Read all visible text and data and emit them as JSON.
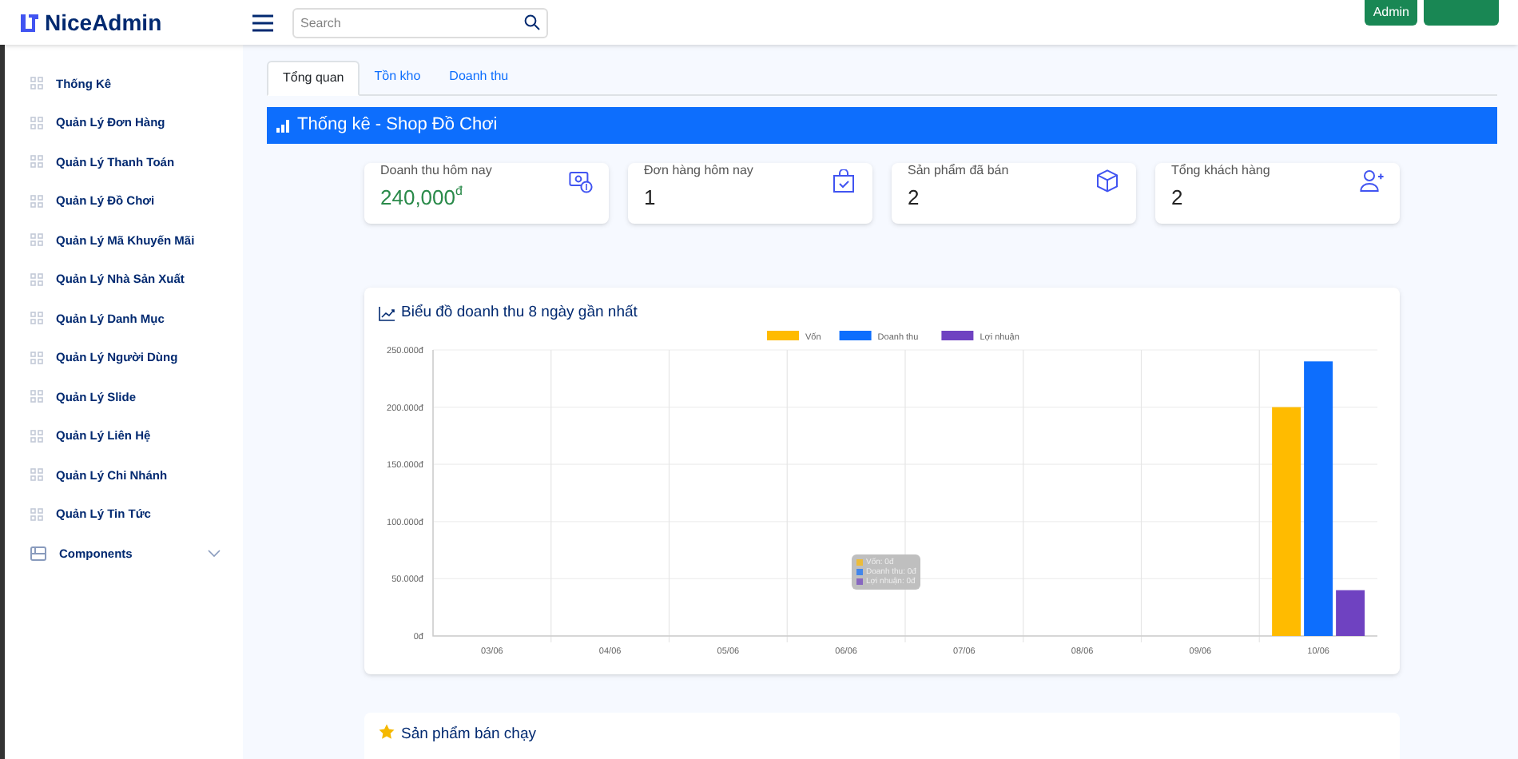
{
  "header": {
    "logo": "NiceAdmin",
    "search": {
      "placeholder": "Search"
    },
    "buttons": [
      "Admin"
    ]
  },
  "sidebar": {
    "items": [
      {
        "label": "Thống Kê",
        "kind": "link"
      },
      {
        "label": "Quản Lý Đơn Hàng",
        "kind": "link"
      },
      {
        "label": "Quản Lý Thanh Toán",
        "kind": "link"
      },
      {
        "label": "Quản Lý Đồ Chơi",
        "kind": "link"
      },
      {
        "label": "Quản Lý Mã Khuyến Mãi",
        "kind": "link"
      },
      {
        "label": "Quản Lý Nhà Sản Xuất",
        "kind": "link"
      },
      {
        "label": "Quản Lý Danh Mục",
        "kind": "link"
      },
      {
        "label": "Quản Lý Người Dùng",
        "kind": "link"
      },
      {
        "label": "Quản Lý Slide",
        "kind": "link"
      },
      {
        "label": "Quản Lý Liên Hệ",
        "kind": "link"
      },
      {
        "label": "Quản Lý Chi Nhánh",
        "kind": "link"
      },
      {
        "label": "Quản Lý Tin Tức",
        "kind": "link"
      },
      {
        "label": "Components",
        "kind": "group",
        "expanded": false
      }
    ]
  },
  "tabs": [
    {
      "label": "Tổng quan",
      "selected": true
    },
    {
      "label": "Tồn kho",
      "selected": false
    },
    {
      "label": "Doanh thu",
      "selected": false
    }
  ],
  "banner": "Thống kê - Shop Đồ Chơi",
  "stats": [
    {
      "label": "Doanh thu hôm nay",
      "value": "240,000",
      "unit": "đ",
      "kind": "money"
    },
    {
      "label": "Đơn hàng hôm nay",
      "value": "1",
      "kind": "bag"
    },
    {
      "label": "Sản phẩm đã bán",
      "value": "2",
      "kind": "box"
    },
    {
      "label": "Tổng khách hàng",
      "value": "2",
      "kind": "user"
    }
  ],
  "chart": {
    "title": "Biểu đồ doanh thu 8 ngày gần nhất",
    "chart_data": {
      "type": "bar",
      "categories": [
        "03/06",
        "04/06",
        "05/06",
        "06/06",
        "07/06",
        "08/06",
        "09/06",
        "10/06"
      ],
      "series": [
        {
          "name": "Vốn",
          "color": "#ffbb00",
          "values": [
            0,
            0,
            0,
            0,
            0,
            0,
            0,
            200000
          ]
        },
        {
          "name": "Doanh thu",
          "color": "#0d6efd",
          "values": [
            0,
            0,
            0,
            0,
            0,
            0,
            0,
            240000
          ]
        },
        {
          "name": "Lợi nhuận",
          "color": "#6f42c1",
          "values": [
            0,
            0,
            0,
            0,
            0,
            0,
            0,
            40000
          ]
        }
      ],
      "ylim": [
        0,
        250000
      ],
      "grid": true,
      "legend": true,
      "yticks": [
        {
          "value": 0,
          "label": "0đ"
        },
        {
          "value": 50000,
          "label": "50.000đ"
        },
        {
          "value": 100000,
          "label": "100.000đ"
        },
        {
          "value": 150000,
          "label": "150.000đ"
        },
        {
          "value": 200000,
          "label": "200.000đ"
        },
        {
          "value": 250000,
          "label": "250.000đ"
        }
      ]
    },
    "tooltip": [
      "Vốn: 0đ",
      "Doanh thu: 0đ",
      "Lợi nhuận: 0đ"
    ]
  },
  "bestsellers": {
    "title": "Sản phẩm bán chạy"
  }
}
